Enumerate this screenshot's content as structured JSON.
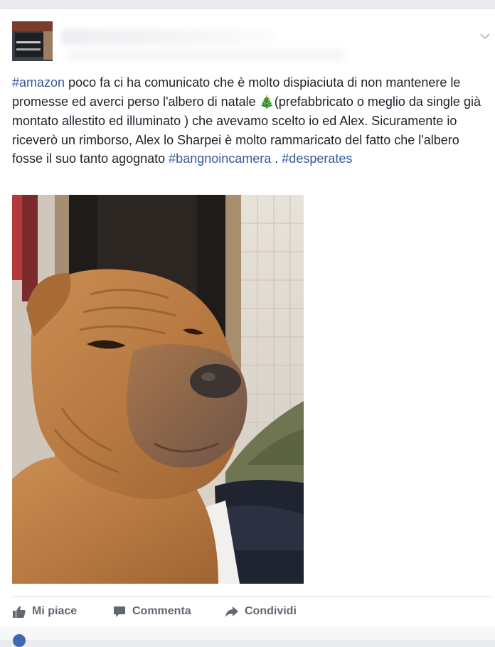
{
  "post": {
    "hashtag_amazon": "#amazon",
    "text_part1": " poco fa ci ha comunicato che è molto dispiaciuta di non mantenere le promesse ed averci perso l'albero di natale ",
    "tree_emoji": "🎄",
    "text_part2": "(prefabbricato o meglio da single già montato allestito ed illuminato ) che avevamo scelto io ed Alex. Sicuramente io riceverò un rimborso, Alex lo Sharpei è molto rammaricato del fatto che l'albero fosse il suo tanto agognato ",
    "hashtag_bangnoincamera": "#bangnoincamera",
    "separator": " . ",
    "hashtag_desperates": "#desperates"
  },
  "actions": {
    "like_label": "Mi piace",
    "comment_label": "Commenta",
    "share_label": "Condividi"
  },
  "icons": {
    "like": "thumbs-up-icon",
    "comment": "comment-bubble-icon",
    "share": "share-arrow-icon",
    "menu": "chevron-down-icon"
  },
  "colors": {
    "hashtag": "#365899",
    "action_text": "#606770",
    "body_text": "#1d2129"
  }
}
